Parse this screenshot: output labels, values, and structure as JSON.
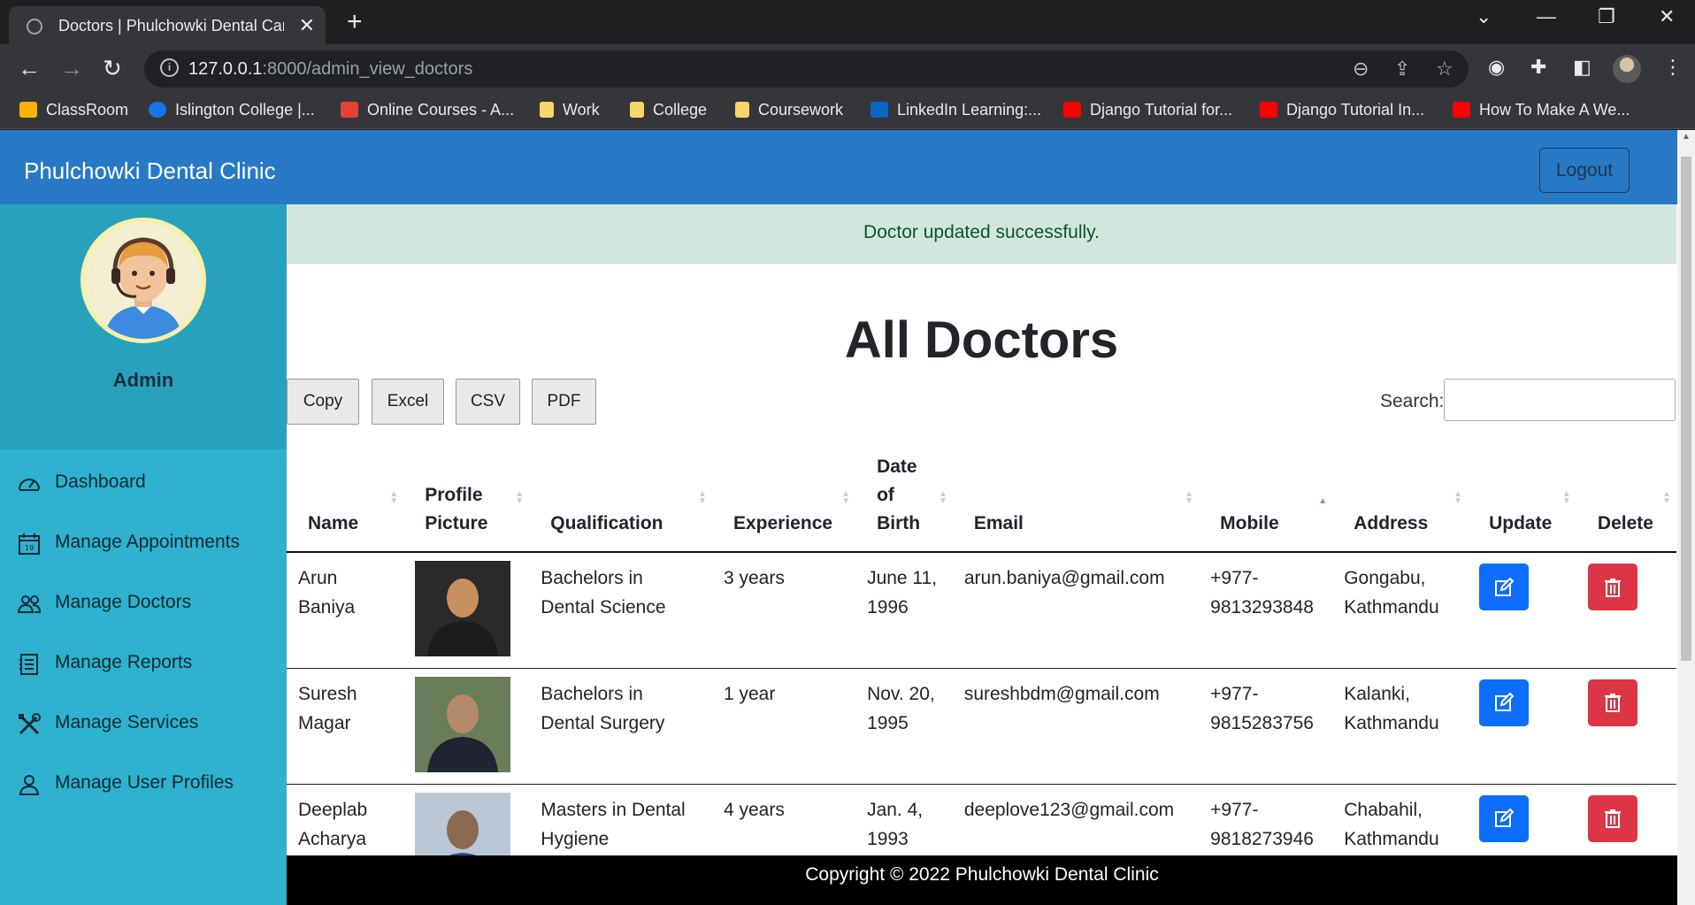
{
  "browser": {
    "tab_title": "Doctors | Phulchowki Dental Care",
    "new_tab": "+",
    "tab_close": "✕",
    "url_host": "127.0.0.1",
    "url_path": ":8000/admin_view_doctors",
    "bookmarks": [
      {
        "label": "ClassRoom",
        "color": "#f6b400"
      },
      {
        "label": "Islington College |...",
        "color": "#1a73e8"
      },
      {
        "label": "Online Courses - A...",
        "color": "#e34234"
      },
      {
        "label": "Work",
        "color": "#f9d56e"
      },
      {
        "label": "College",
        "color": "#f9d56e"
      },
      {
        "label": "Coursework",
        "color": "#f9d56e"
      },
      {
        "label": "LinkedIn Learning:...",
        "color": "#0a66c2"
      },
      {
        "label": "Django Tutorial for...",
        "color": "#ff0000"
      },
      {
        "label": "Django Tutorial In...",
        "color": "#ff0000"
      },
      {
        "label": "How To Make A We...",
        "color": "#ff0000"
      }
    ]
  },
  "navbar": {
    "brand": "Phulchowki Dental Clinic",
    "logout": "Logout",
    "color": "#2779c5"
  },
  "sidebar": {
    "user": "Admin",
    "items": [
      {
        "label": "Dashboard",
        "icon": "speedometer-icon"
      },
      {
        "label": "Manage Appointments",
        "icon": "calendar-icon"
      },
      {
        "label": "Manage Doctors",
        "icon": "people-icon"
      },
      {
        "label": "Manage Reports",
        "icon": "report-icon"
      },
      {
        "label": "Manage Services",
        "icon": "tools-icon"
      },
      {
        "label": "Manage User Profiles",
        "icon": "person-icon"
      }
    ]
  },
  "main": {
    "alert": "Doctor updated successfully.",
    "heading": "All Doctors",
    "buttons": [
      "Copy",
      "Excel",
      "CSV",
      "PDF"
    ],
    "search_label": "Search:",
    "search_value": "",
    "columns": [
      {
        "label": "Name",
        "lines": [
          "Name"
        ]
      },
      {
        "label": "Profile Picture",
        "lines": [
          "Profile",
          "Picture"
        ]
      },
      {
        "label": "Qualification",
        "lines": [
          "Qualification"
        ]
      },
      {
        "label": "Experience",
        "lines": [
          "Experience"
        ]
      },
      {
        "label": "Date of Birth",
        "lines": [
          "Date",
          "of",
          "Birth"
        ]
      },
      {
        "label": "Email",
        "lines": [
          "Email"
        ]
      },
      {
        "label": "Mobile",
        "lines": [
          "Mobile"
        ],
        "sorted": "asc"
      },
      {
        "label": "Address",
        "lines": [
          "Address"
        ]
      },
      {
        "label": "Update",
        "lines": [
          "Update"
        ]
      },
      {
        "label": "Delete",
        "lines": [
          "Delete"
        ]
      }
    ],
    "rows": [
      {
        "name": [
          "Arun",
          "Baniya"
        ],
        "qualification": [
          "Bachelors in",
          "Dental Science"
        ],
        "experience": "3 years",
        "dob": [
          "June 11,",
          "1996"
        ],
        "email": "arun.baniya@gmail.com",
        "mobile": [
          "+977-",
          "9813293848"
        ],
        "address": [
          "Gongabu,",
          "Kathmandu"
        ]
      },
      {
        "name": [
          "Suresh",
          "Magar"
        ],
        "qualification": [
          "Bachelors in",
          "Dental Surgery"
        ],
        "experience": "1 year",
        "dob": [
          "Nov. 20,",
          "1995"
        ],
        "email": "sureshbdm@gmail.com",
        "mobile": [
          "+977-",
          "9815283756"
        ],
        "address": [
          "Kalanki,",
          "Kathmandu"
        ]
      },
      {
        "name": [
          "Deeplab",
          "Acharya"
        ],
        "qualification": [
          "Masters in Dental",
          "Hygiene"
        ],
        "experience": "4 years",
        "dob": [
          "Jan. 4,",
          "1993"
        ],
        "email": "deeplove123@gmail.com",
        "mobile": [
          "+977-",
          "9818273946"
        ],
        "address": [
          "Chabahil,",
          "Kathmandu"
        ]
      }
    ]
  },
  "footer": {
    "text": "Copyright © 2022 Phulchowki Dental Clinic"
  }
}
